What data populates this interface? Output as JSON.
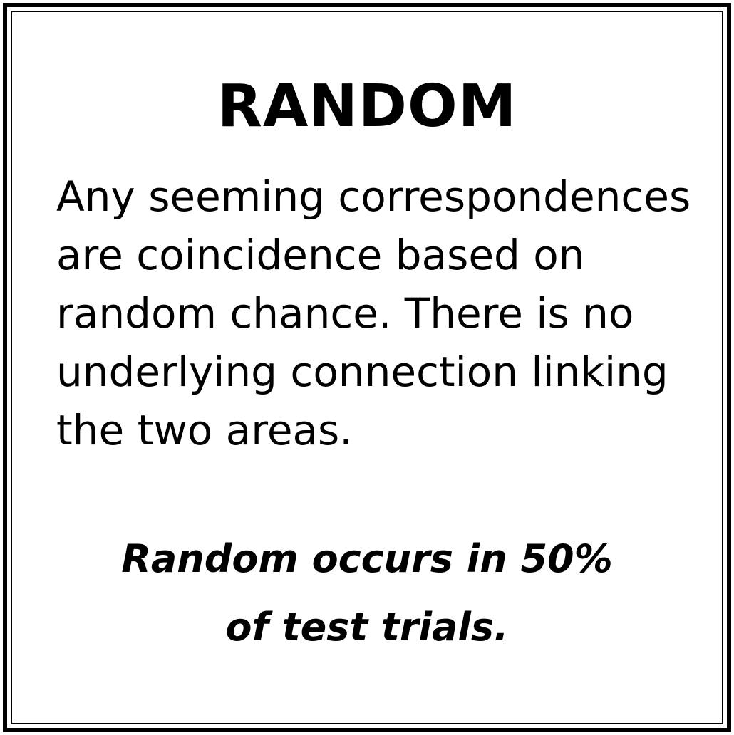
{
  "card": {
    "title": "RANDOM",
    "description": "Any seeming correspondences are coincidence based on random chance. There is no underlying connection linking the two areas.",
    "note_line_1": "Random occurs in 50%",
    "note_line_2": "of test trials."
  },
  "colors": {
    "border": "#000000",
    "background": "#ffffff",
    "text": "#000000"
  }
}
